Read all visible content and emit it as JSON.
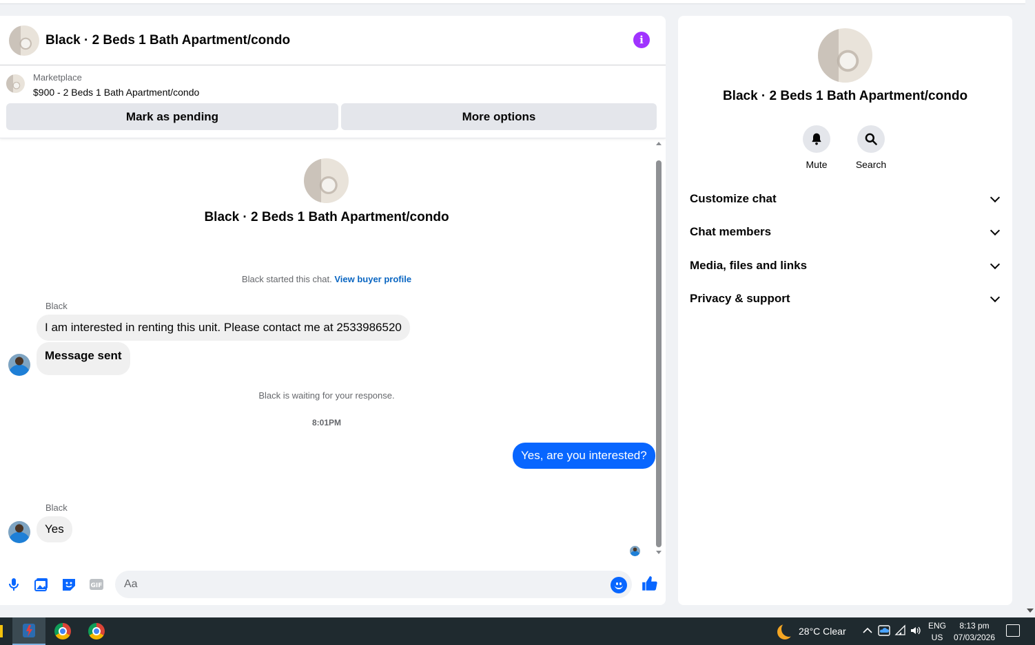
{
  "chat": {
    "title": "Black · 2 Beds 1 Bath Apartment/condo",
    "listing": {
      "source": "Marketplace",
      "price_title": "$900 - 2 Beds 1 Bath Apartment/condo",
      "mark_pending_label": "Mark as pending",
      "more_options_label": "More options"
    },
    "conversation_title": "Black · 2 Beds 1 Bath Apartment/condo",
    "started_text": "Black started this chat.",
    "view_profile_link": "View buyer profile",
    "messages": [
      {
        "sender": "Black",
        "text": "I am interested in renting this unit. Please contact me at 2533986520"
      },
      {
        "text": "Message sent"
      },
      {
        "system": "Black is waiting for your response."
      },
      {
        "timestamp": "8:01PM"
      },
      {
        "outgoing": true,
        "text": "Yes, are you interested?"
      },
      {
        "sender": "Black",
        "text": "Yes"
      }
    ],
    "composer_placeholder": "Aa"
  },
  "info_panel": {
    "title": "Black · 2 Beds 1 Bath Apartment/condo",
    "actions": [
      {
        "label": "Mute",
        "icon": "bell-icon"
      },
      {
        "label": "Search",
        "icon": "search-icon"
      }
    ],
    "sections": [
      "Customize chat",
      "Chat members",
      "Media, files and links",
      "Privacy & support"
    ]
  },
  "taskbar": {
    "weather": "28°C  Clear",
    "lang_top": "ENG",
    "lang_bottom": "US",
    "time": "8:13 pm",
    "date": "07/03/2026"
  },
  "colors": {
    "accent": "#0866ff",
    "info": "#a033ff",
    "link": "#0a66c2"
  }
}
